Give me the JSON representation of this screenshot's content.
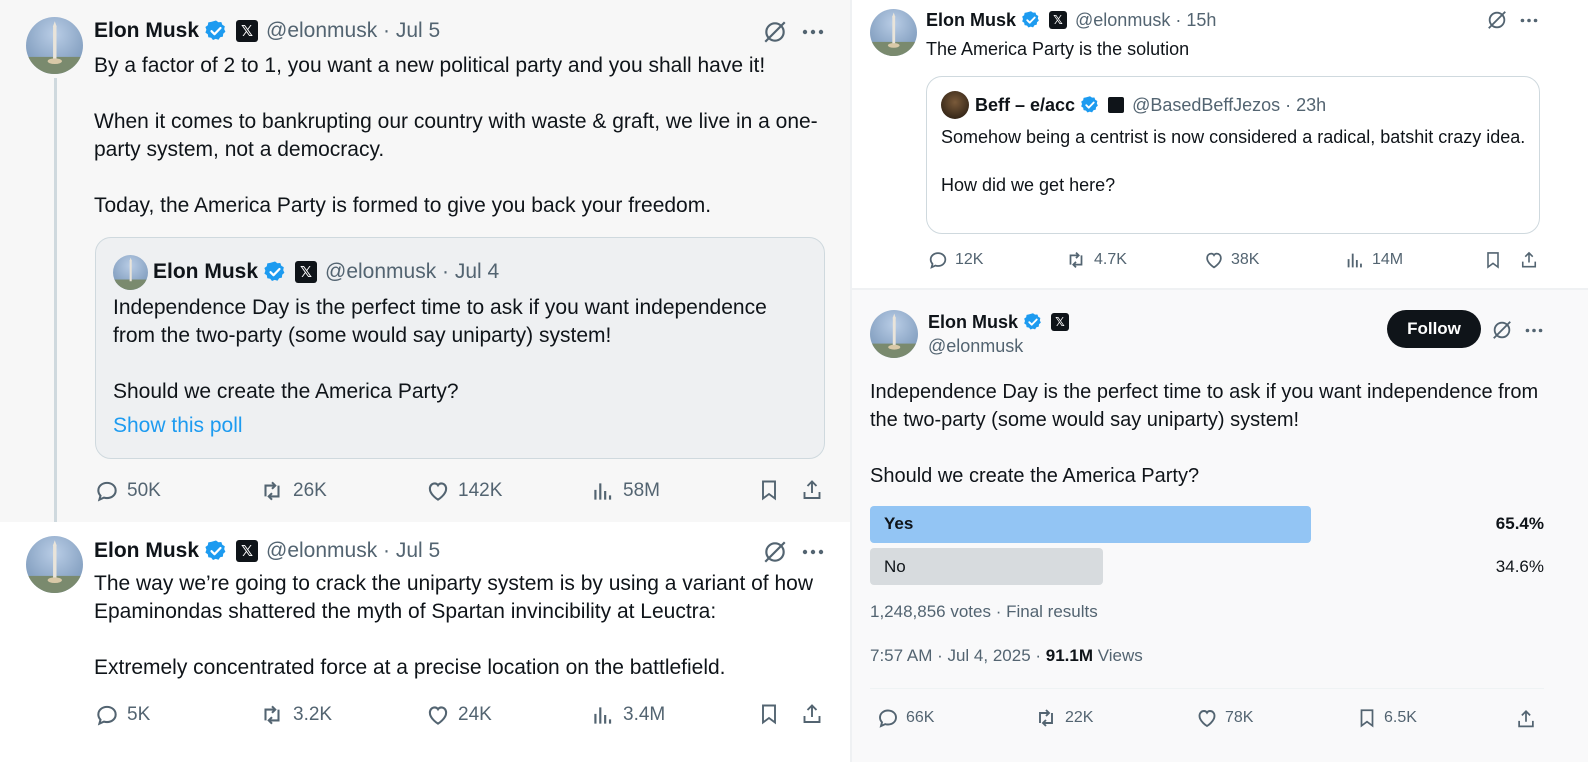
{
  "colors": {
    "accent": "#1d9bf0",
    "poll_winner": "#93c5f4",
    "poll_other": "#d7dbde"
  },
  "tweet1": {
    "name": "Elon Musk",
    "handle_time": "@elonmusk · Jul 5",
    "text": "By a factor of 2 to 1, you want a new political party and you shall have it!\n\nWhen it comes to bankrupting our country with waste & graft, we live in a one-party system, not a democracy.\n\nToday, the America Party is formed to give you back your freedom.",
    "quote": {
      "name": "Elon Musk",
      "handle_time": "@elonmusk · Jul 4",
      "text": "Independence Day is the perfect time to ask if you want independence from the two-party (some would say uniparty) system!\n\nShould we create the America Party?",
      "show_poll": "Show this poll"
    },
    "replies": "50K",
    "reposts": "26K",
    "likes": "142K",
    "views": "58M"
  },
  "tweet2": {
    "name": "Elon Musk",
    "handle_time": "@elonmusk · Jul 5",
    "text": "The way we’re going to crack the uniparty system is by using a variant of how Epaminondas shattered the myth of Spartan invincibility at Leuctra:\n\nExtremely concentrated force at a precise location on the battlefield.",
    "replies": "5K",
    "reposts": "3.2K",
    "likes": "24K",
    "views": "3.4M"
  },
  "tweet3": {
    "name": "Elon Musk",
    "handle_time": "@elonmusk · 15h",
    "text": "The America Party is the solution",
    "quote": {
      "name": "Beff – e/acc",
      "handle_time": "@BasedBeffJezos · 23h",
      "text": "Somehow being a centrist is now considered a radical, batshit crazy idea.\n\nHow did we get here?"
    },
    "replies": "12K",
    "reposts": "4.7K",
    "likes": "38K",
    "views": "14M"
  },
  "tweet4": {
    "name": "Elon Musk",
    "handle": "@elonmusk",
    "follow_label": "Follow",
    "text": "Independence Day is the perfect time to ask if you want independence from the two-party (some would say uniparty) system!\n\nShould we create the America Party?",
    "poll": {
      "options": [
        {
          "label": "Yes",
          "percent": "65.4%",
          "fraction": 0.654
        },
        {
          "label": "No",
          "percent": "34.6%",
          "fraction": 0.346
        }
      ],
      "summary": "1,248,856 votes · Final results"
    },
    "timestamp": "7:57 AM · Jul 4, 2025 · ",
    "views_count": "91.1M",
    "views_label": " Views",
    "replies": "66K",
    "reposts": "22K",
    "likes": "78K",
    "bookmarks": "6.5K"
  }
}
